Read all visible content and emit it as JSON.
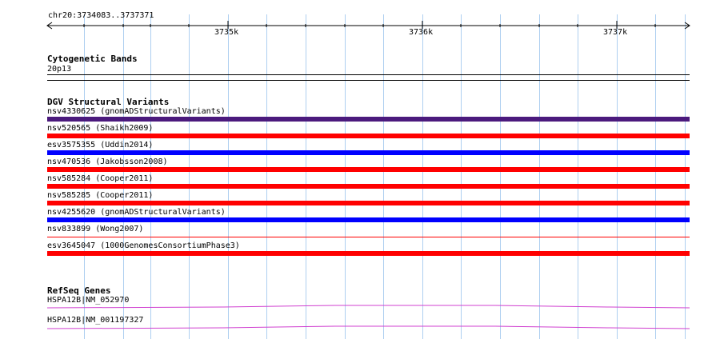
{
  "ruler": {
    "position_label": "chr20:3734083..3737371",
    "ticks": [
      "3735k",
      "3736k",
      "3737k"
    ]
  },
  "tracks": {
    "cytobands": {
      "title": "Cytogenetic Bands",
      "band": "20p13"
    },
    "dgv": {
      "title": "DGV Structural Variants",
      "items": [
        {
          "label": "nsv4330625 (gnomADStructuralVariants)",
          "color": "#4b1a7d"
        },
        {
          "label": "nsv520565 (Shaikh2009)",
          "color": "#ff0000"
        },
        {
          "label": "esv3575355 (Uddin2014)",
          "color": "#0000ff"
        },
        {
          "label": "nsv470536 (Jakobsson2008)",
          "color": "#ff0000"
        },
        {
          "label": "nsv585284 (Cooper2011)",
          "color": "#ff0000"
        },
        {
          "label": "nsv585285 (Cooper2011)",
          "color": "#ff0000"
        },
        {
          "label": "nsv4255620 (gnomADStructuralVariants)",
          "color": "#0000ff"
        },
        {
          "label": "nsv833899 (Wong2007)",
          "color": "#ff0000"
        },
        {
          "label": "esv3645047 (1000GenomesConsortiumPhase3)",
          "color": "#ff0000"
        }
      ]
    },
    "refseq": {
      "title": "RefSeq Genes",
      "items": [
        {
          "label": "HSPA12B|NM_052970",
          "color": "#d040d0"
        },
        {
          "label": "HSPA12B|NM_001197327",
          "color": "#d040d0"
        }
      ]
    }
  }
}
